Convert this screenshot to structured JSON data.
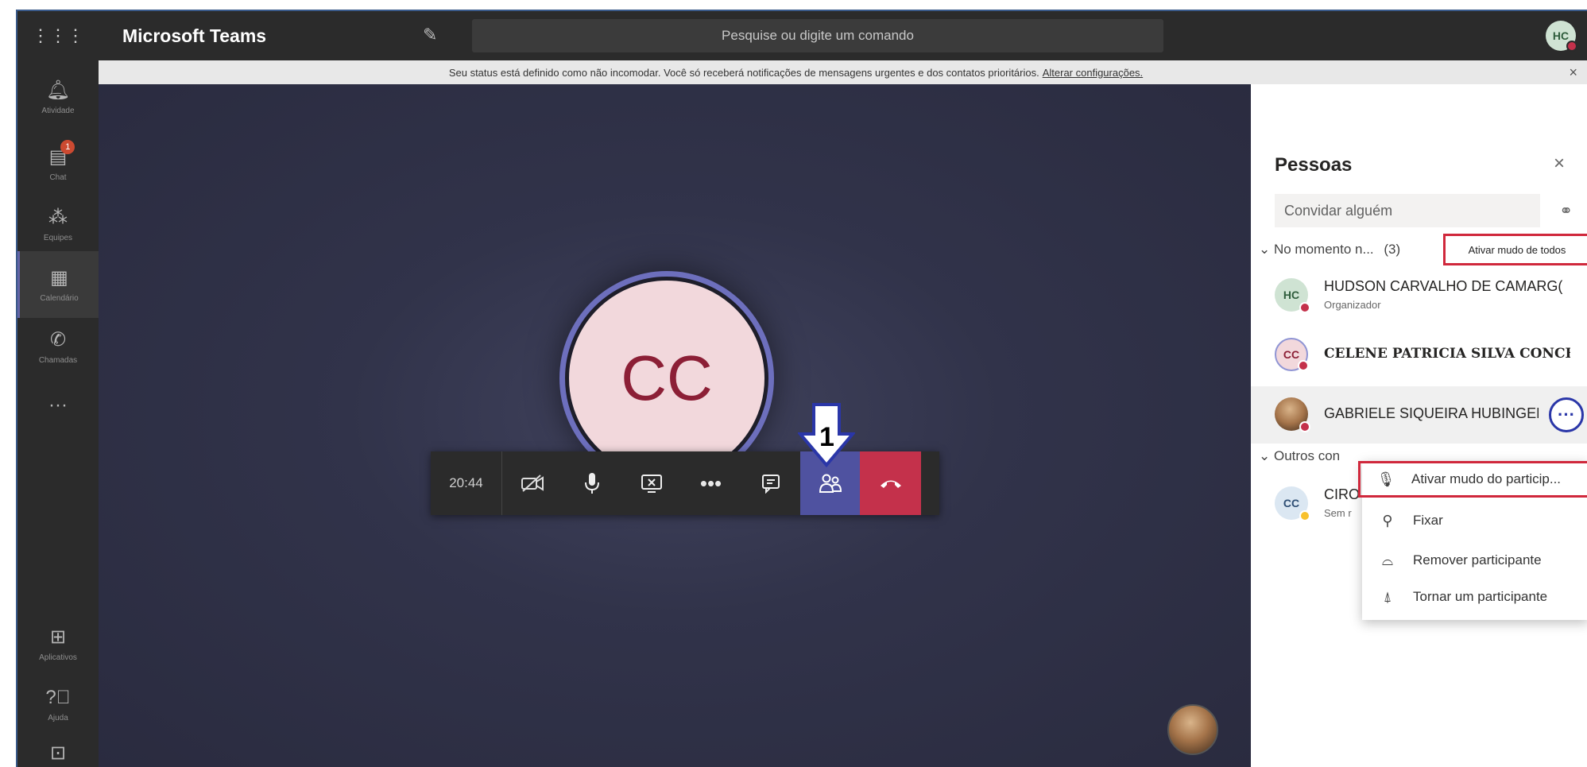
{
  "app": {
    "title": "Microsoft Teams"
  },
  "search": {
    "placeholder": "Pesquise ou digite um comando"
  },
  "me": {
    "initials": "HC"
  },
  "rail": [
    {
      "label": "Atividade",
      "icon": "bell-icon"
    },
    {
      "label": "Chat",
      "icon": "chat-icon",
      "badge": "1"
    },
    {
      "label": "Equipes",
      "icon": "teams-icon"
    },
    {
      "label": "Calendário",
      "icon": "calendar-icon"
    },
    {
      "label": "Chamadas",
      "icon": "phone-icon"
    },
    {
      "label": "",
      "icon": "more-apps-icon"
    },
    {
      "label": "Aplicativos",
      "icon": "apps-icon"
    },
    {
      "label": "Ajuda",
      "icon": "help-icon"
    },
    {
      "label": "",
      "icon": "download-icon"
    }
  ],
  "notice": {
    "text": "Seu status está definido como não incomodar. Você só receberá notificações de mensagens urgentes e dos contatos prioritários.",
    "link": "Alterar configurações."
  },
  "call": {
    "main_initials": "CC",
    "time": "20:44",
    "arrow_label": "1"
  },
  "people_pane": {
    "title": "Pessoas",
    "invite_placeholder": "Convidar alguém",
    "current_section": "No momento n...",
    "current_count": "(3)",
    "mute_all": "Ativar mudo de todos",
    "participants": [
      {
        "initials": "HC",
        "name": "HUDSON CARVALHO DE CAMARG(",
        "role": "Organizador",
        "status_color": "#c4314b"
      },
      {
        "initials": "CC",
        "name": "CELENE PATRICIA SILVA CONCEI.",
        "role": "",
        "status_color": "#c4314b"
      },
      {
        "initials": "",
        "name": "GABRIELE SIQUEIRA HUBINGER",
        "role": "",
        "status_color": "#c4314b"
      }
    ],
    "others_section": "Outros con",
    "others": [
      {
        "initials": "CC",
        "name": "CIRO",
        "role": "Sem r",
        "status_color": "#f8c12c"
      }
    ]
  },
  "context_menu": {
    "items": [
      {
        "label": "Ativar mudo do particip...",
        "icon": "microphone-icon"
      },
      {
        "label": "Fixar",
        "icon": "pin-icon"
      },
      {
        "label": "Remover participante",
        "icon": "remove-person-icon"
      },
      {
        "label": "Tornar um participante",
        "icon": "attendee-icon"
      }
    ]
  }
}
